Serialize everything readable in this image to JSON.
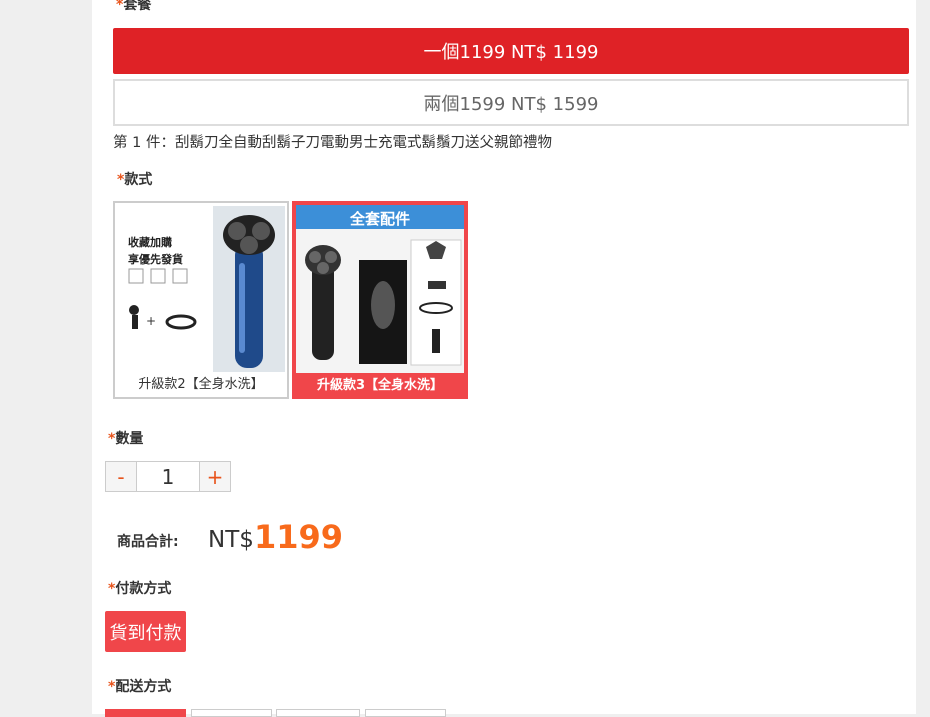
{
  "package": {
    "label": "套餐",
    "options": [
      {
        "label": "一個1199 NT$ 1199",
        "selected": true
      },
      {
        "label": "兩個1599 NT$ 1599",
        "selected": false
      }
    ],
    "item_description": "第 1 件：刮鬍刀全自動刮鬍子刀電動男士充電式鬍鬚刀送父親節禮物"
  },
  "style": {
    "label": "款式",
    "options": [
      {
        "caption": "升級款2【全身水洗】",
        "selected": false,
        "image_text": [
          "收藏加購",
          "享優先發貨"
        ]
      },
      {
        "caption": "升級款3【全身水洗】",
        "selected": true,
        "image_text": [
          "全套配件"
        ]
      }
    ]
  },
  "quantity": {
    "label": "數量",
    "minus": "-",
    "value": "1",
    "plus": "+"
  },
  "total": {
    "label": "商品合計:",
    "currency": "NT$",
    "amount": "1199"
  },
  "payment": {
    "label": "付款方式",
    "selected": "貨到付款"
  },
  "shipping": {
    "label": "配送方式"
  },
  "colors": {
    "accent_red": "#df2226",
    "selected_red": "#f0464a",
    "price_orange": "#f86a1b",
    "required_mark": "#e8541c"
  }
}
